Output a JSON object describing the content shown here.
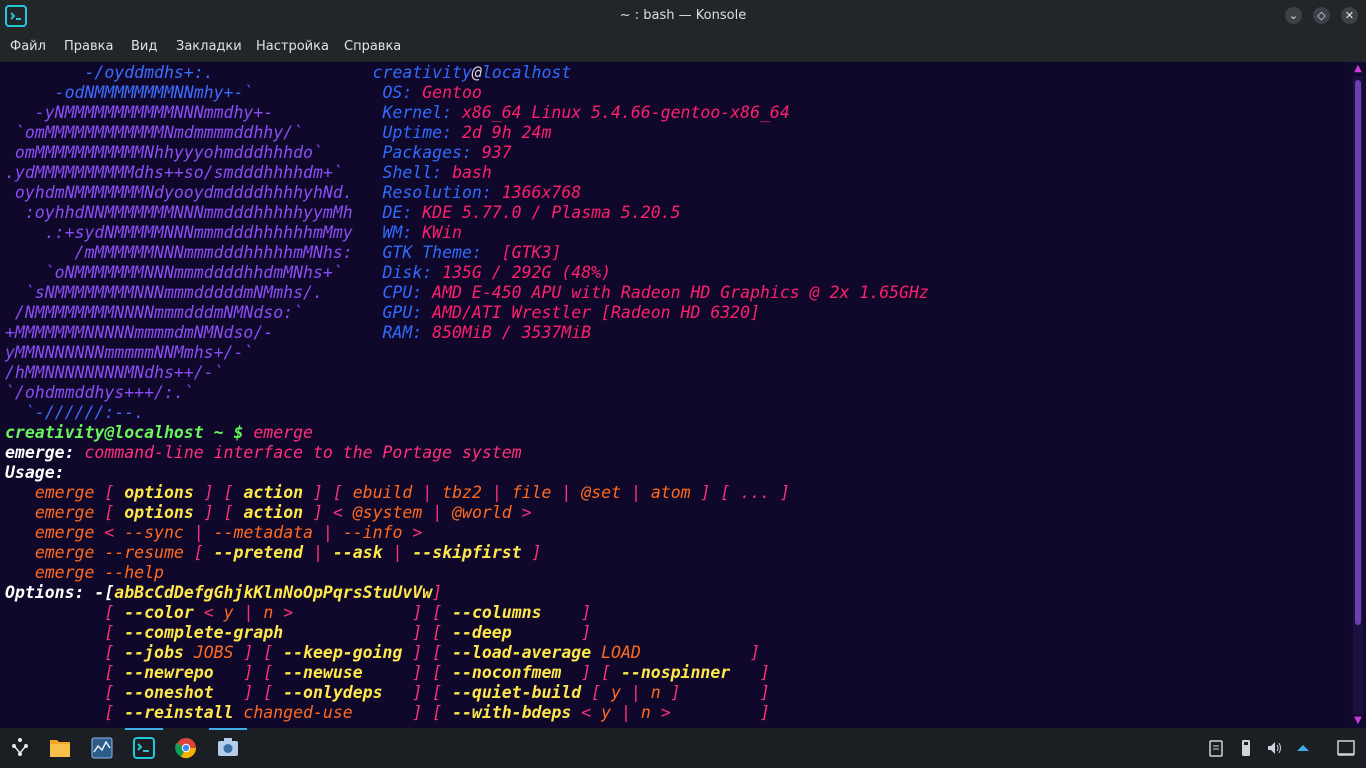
{
  "window": {
    "title": "~ : bash — Konsole"
  },
  "menu": [
    "Файл",
    "Правка",
    "Вид",
    "Закладки",
    "Настройка",
    "Справка"
  ],
  "colors": {
    "logo": "#3c6cfc",
    "logo_alt": "#8a4df5",
    "info_key": "#2f6bff",
    "info_val": "#ff1f6e",
    "white": "#ffffff",
    "yellow": "#ffe84a",
    "orange": "#ff6a1f",
    "pink": "#ff2f7a",
    "green": "#67f55a",
    "at": "#d6d0e0"
  },
  "terminal": {
    "lines": [
      [
        [
          "        -/oyddmdhs+:.",
          "logo"
        ],
        [
          "                ",
          ""
        ],
        [
          "creativity",
          "info_key"
        ],
        [
          "@",
          "at"
        ],
        [
          "localhost",
          "info_key"
        ]
      ],
      [
        [
          "     -odNMMMMMMMMNNmhy+-`",
          "logo"
        ],
        [
          "             ",
          ""
        ],
        [
          "OS: ",
          "info_key"
        ],
        [
          "Gentoo",
          "info_val"
        ]
      ],
      [
        [
          "   -yNMMMMMMMMMMMNNNmmdhy+-",
          "logo_alt"
        ],
        [
          "           ",
          ""
        ],
        [
          "Kernel: ",
          "info_key"
        ],
        [
          "x86_64 Linux 5.4.66-gentoo-x86_64",
          "info_val"
        ]
      ],
      [
        [
          " `omMMMMMMMMMMMMNmdmmmmddhhy/`",
          "logo_alt"
        ],
        [
          "        ",
          ""
        ],
        [
          "Uptime: ",
          "info_key"
        ],
        [
          "2d 9h 24m",
          "info_val"
        ]
      ],
      [
        [
          " omMMMMMMMMMMMNhhyyyohmdddhhhdo`",
          "logo_alt"
        ],
        [
          "      ",
          ""
        ],
        [
          "Packages: ",
          "info_key"
        ],
        [
          "937",
          "info_val"
        ]
      ],
      [
        [
          ".ydMMMMMMMMMMdhs++so/smdddhhhhdm+`",
          "logo_alt"
        ],
        [
          "    ",
          ""
        ],
        [
          "Shell: ",
          "info_key"
        ],
        [
          "bash",
          "info_val"
        ]
      ],
      [
        [
          " oyhdmNMMMMMMMNdyooydmddddhhhhyhNd.",
          "logo_alt"
        ],
        [
          "   ",
          ""
        ],
        [
          "Resolution: ",
          "info_key"
        ],
        [
          "1366x768",
          "info_val"
        ]
      ],
      [
        [
          "  :oyhhdNNMMMMMMMNNNmmdddhhhhhyymMh",
          "logo_alt"
        ],
        [
          "   ",
          ""
        ],
        [
          "DE: ",
          "info_key"
        ],
        [
          "KDE 5.77.0 / Plasma 5.20.5",
          "info_val"
        ]
      ],
      [
        [
          "    .:+sydNMMMMMNNNmmmdddhhhhhhmMmy",
          "logo_alt"
        ],
        [
          "   ",
          ""
        ],
        [
          "WM: ",
          "info_key"
        ],
        [
          "KWin",
          "info_val"
        ]
      ],
      [
        [
          "       /mMMMMMMNNNmmmdddhhhhhmMNhs:",
          "logo_alt"
        ],
        [
          "   ",
          ""
        ],
        [
          "GTK Theme: ",
          "info_key"
        ],
        [
          " [GTK3]",
          "info_val"
        ]
      ],
      [
        [
          "    `oNMMMMMMMNNNmmmddddhhdmMNhs+`",
          "logo_alt"
        ],
        [
          "    ",
          ""
        ],
        [
          "Disk: ",
          "info_key"
        ],
        [
          "135G / 292G (48%)",
          "info_val"
        ]
      ],
      [
        [
          "  `sNMMMMMMMMNNNmmmdddddmNMmhs/.",
          "logo_alt"
        ],
        [
          "      ",
          ""
        ],
        [
          "CPU: ",
          "info_key"
        ],
        [
          "AMD E-450 APU with Radeon HD Graphics @ 2x 1.65GHz",
          "info_val"
        ]
      ],
      [
        [
          " /NMMMMMMMMNNNNmmmdddmNMNdso:`",
          "logo_alt"
        ],
        [
          "        ",
          ""
        ],
        [
          "GPU: ",
          "info_key"
        ],
        [
          "AMD/ATI Wrestler [Radeon HD 6320]",
          "info_val"
        ]
      ],
      [
        [
          "+MMMMMMMNNNNNmmmmdmNMNdso/-",
          "logo_alt"
        ],
        [
          "           ",
          ""
        ],
        [
          "RAM: ",
          "info_key"
        ],
        [
          "850MiB / 3537MiB",
          "info_val"
        ]
      ],
      [
        [
          "yMMNNNNNNNmmmmmNNMmhs+/-`",
          "logo_alt"
        ]
      ],
      [
        [
          "/hMMNNNNNNNNMNdhs++/-`",
          "logo_alt"
        ]
      ],
      [
        [
          "`/ohdmmddhys+++/:.`",
          "logo_alt"
        ]
      ],
      [
        [
          "  `-//////:--.",
          "logo"
        ]
      ],
      [
        [
          "creativity@localhost ~ $ ",
          "green"
        ],
        [
          "emerge",
          "pink"
        ]
      ],
      [
        [
          "emerge: ",
          "white"
        ],
        [
          "command-line interface to the Portage system",
          "pink"
        ]
      ],
      [
        [
          "Usage:",
          "white"
        ]
      ],
      [
        [
          "   ",
          ""
        ],
        [
          "emerge",
          "orange"
        ],
        [
          " [ ",
          "pink"
        ],
        [
          "options",
          "yellow"
        ],
        [
          " ] [ ",
          "pink"
        ],
        [
          "action",
          "yellow"
        ],
        [
          " ] [ ",
          "pink"
        ],
        [
          "ebuild",
          "orange"
        ],
        [
          " | ",
          "pink"
        ],
        [
          "tbz2",
          "orange"
        ],
        [
          " | ",
          "pink"
        ],
        [
          "file",
          "orange"
        ],
        [
          " | ",
          "pink"
        ],
        [
          "@set",
          "orange"
        ],
        [
          " | ",
          "pink"
        ],
        [
          "atom",
          "orange"
        ],
        [
          " ] [ ... ]",
          "pink"
        ]
      ],
      [
        [
          "   ",
          ""
        ],
        [
          "emerge",
          "orange"
        ],
        [
          " [ ",
          "pink"
        ],
        [
          "options",
          "yellow"
        ],
        [
          " ] [ ",
          "pink"
        ],
        [
          "action",
          "yellow"
        ],
        [
          " ] < ",
          "pink"
        ],
        [
          "@system",
          "orange"
        ],
        [
          " | ",
          "pink"
        ],
        [
          "@world",
          "orange"
        ],
        [
          " >",
          "pink"
        ]
      ],
      [
        [
          "   ",
          ""
        ],
        [
          "emerge",
          "orange"
        ],
        [
          " < ",
          "pink"
        ],
        [
          "--sync",
          "orange"
        ],
        [
          " | ",
          "pink"
        ],
        [
          "--metadata",
          "orange"
        ],
        [
          " | ",
          "pink"
        ],
        [
          "--info",
          "orange"
        ],
        [
          " >",
          "pink"
        ]
      ],
      [
        [
          "   ",
          ""
        ],
        [
          "emerge",
          "orange"
        ],
        [
          " --resume",
          "orange"
        ],
        [
          " [ ",
          "pink"
        ],
        [
          "--pretend",
          "yellow"
        ],
        [
          " | ",
          "pink"
        ],
        [
          "--ask",
          "yellow"
        ],
        [
          " | ",
          "pink"
        ],
        [
          "--skipfirst",
          "yellow"
        ],
        [
          " ]",
          "pink"
        ]
      ],
      [
        [
          "   ",
          ""
        ],
        [
          "emerge",
          "orange"
        ],
        [
          " --help",
          "orange"
        ]
      ],
      [
        [
          "Options: ",
          "white"
        ],
        [
          "-[",
          "white"
        ],
        [
          "abBcCdDefgGhjkKlnNoOpPqrsStuUvVw",
          "yellow"
        ],
        [
          "]",
          "pink"
        ]
      ],
      [
        [
          "          ",
          ""
        ],
        [
          "[ ",
          "pink"
        ],
        [
          "--color",
          "yellow"
        ],
        [
          " < ",
          "pink"
        ],
        [
          "y",
          "orange"
        ],
        [
          " | ",
          "pink"
        ],
        [
          "n",
          "orange"
        ],
        [
          " >",
          "pink"
        ],
        [
          "            ] [ ",
          "pink"
        ],
        [
          "--columns",
          "yellow"
        ],
        [
          "    ]",
          "pink"
        ]
      ],
      [
        [
          "          ",
          ""
        ],
        [
          "[ ",
          "pink"
        ],
        [
          "--complete-graph",
          "yellow"
        ],
        [
          "             ] [ ",
          "pink"
        ],
        [
          "--deep",
          "yellow"
        ],
        [
          "       ]",
          "pink"
        ]
      ],
      [
        [
          "          ",
          ""
        ],
        [
          "[ ",
          "pink"
        ],
        [
          "--jobs",
          "yellow"
        ],
        [
          " JOBS",
          "orange"
        ],
        [
          " ] [ ",
          "pink"
        ],
        [
          "--keep-going",
          "yellow"
        ],
        [
          " ] [ ",
          "pink"
        ],
        [
          "--load-average",
          "yellow"
        ],
        [
          " LOAD",
          "orange"
        ],
        [
          "           ]",
          "pink"
        ]
      ],
      [
        [
          "          ",
          ""
        ],
        [
          "[ ",
          "pink"
        ],
        [
          "--newrepo",
          "yellow"
        ],
        [
          "   ] [ ",
          "pink"
        ],
        [
          "--newuse",
          "yellow"
        ],
        [
          "     ] [ ",
          "pink"
        ],
        [
          "--noconfmem",
          "yellow"
        ],
        [
          "  ] [ ",
          "pink"
        ],
        [
          "--nospinner",
          "yellow"
        ],
        [
          "   ]",
          "pink"
        ]
      ],
      [
        [
          "          ",
          ""
        ],
        [
          "[ ",
          "pink"
        ],
        [
          "--oneshot",
          "yellow"
        ],
        [
          "   ] [ ",
          "pink"
        ],
        [
          "--onlydeps",
          "yellow"
        ],
        [
          "   ] [ ",
          "pink"
        ],
        [
          "--quiet-build",
          "yellow"
        ],
        [
          " [ ",
          "pink"
        ],
        [
          "y",
          "orange"
        ],
        [
          " | ",
          "pink"
        ],
        [
          "n",
          "orange"
        ],
        [
          " ]        ]",
          "pink"
        ]
      ],
      [
        [
          "          ",
          ""
        ],
        [
          "[ ",
          "pink"
        ],
        [
          "--reinstall",
          "yellow"
        ],
        [
          " changed-use",
          "orange"
        ],
        [
          "      ] [ ",
          "pink"
        ],
        [
          "--with-bdeps",
          "yellow"
        ],
        [
          " < ",
          "pink"
        ],
        [
          "y",
          "orange"
        ],
        [
          " | ",
          "pink"
        ],
        [
          "n",
          "orange"
        ],
        [
          " >",
          "pink"
        ],
        [
          "         ]",
          "pink"
        ]
      ]
    ]
  },
  "taskbar": {
    "apps": [
      "application-launcher-icon",
      "file-manager-icon",
      "system-monitor-icon",
      "konsole-icon",
      "chrome-icon",
      "screenshot-icon"
    ],
    "tray": [
      "clipboard-icon",
      "usb-device-icon",
      "volume-icon",
      "notifications-arrow-icon",
      "show-desktop-icon"
    ]
  }
}
